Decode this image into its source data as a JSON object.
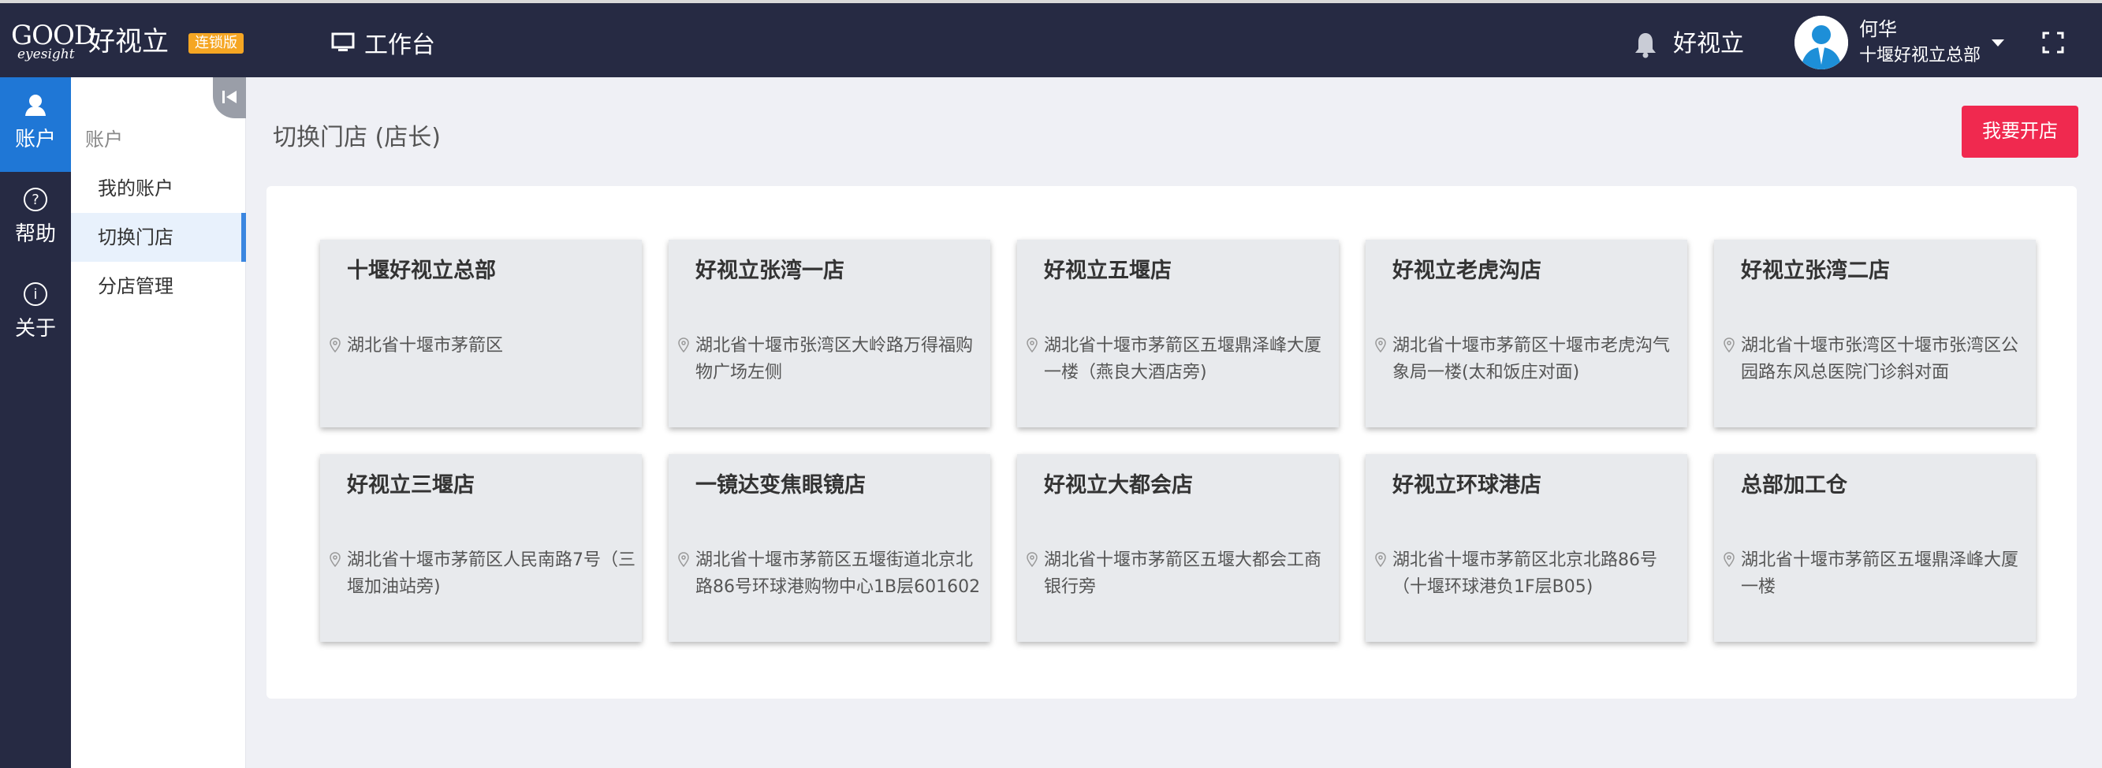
{
  "header": {
    "logo_text": "GOOD",
    "logo_subtext": "eyesight",
    "brand": "好视立",
    "edition_badge": "连锁版",
    "workbench": "工作台",
    "notification_label": "好视立",
    "user_name": "何华",
    "user_org": "十堰好视立总部"
  },
  "rail": {
    "items": [
      {
        "label": "账户",
        "icon": "user-icon"
      },
      {
        "label": "帮助",
        "icon": "help-icon"
      },
      {
        "label": "关于",
        "icon": "info-icon"
      }
    ]
  },
  "submenu": {
    "title": "账户",
    "items": [
      {
        "label": "我的账户"
      },
      {
        "label": "切换门店"
      },
      {
        "label": "分店管理"
      }
    ]
  },
  "main": {
    "page_title": "切换门店 (店长)",
    "open_store_button": "我要开店",
    "stores": [
      {
        "name": "十堰好视立总部",
        "address": "湖北省十堰市茅箭区"
      },
      {
        "name": "好视立张湾一店",
        "address": "湖北省十堰市张湾区大岭路万得福购物广场左侧"
      },
      {
        "name": "好视立五堰店",
        "address": "湖北省十堰市茅箭区五堰鼎泽峰大厦一楼（燕良大酒店旁)"
      },
      {
        "name": "好视立老虎沟店",
        "address": "湖北省十堰市茅箭区十堰市老虎沟气象局一楼(太和饭庄对面)"
      },
      {
        "name": "好视立张湾二店",
        "address": "湖北省十堰市张湾区十堰市张湾区公园路东风总医院门诊斜对面"
      },
      {
        "name": "好视立三堰店",
        "address": "湖北省十堰市茅箭区人民南路7号（三堰加油站旁)"
      },
      {
        "name": "一镜达变焦眼镜店",
        "address": "湖北省十堰市茅箭区五堰街道北京北路86号环球港购物中心1B层601602"
      },
      {
        "name": "好视立大都会店",
        "address": "湖北省十堰市茅箭区五堰大都会工商银行旁"
      },
      {
        "name": "好视立环球港店",
        "address": "湖北省十堰市茅箭区北京北路86号（十堰环球港负1F层B05)"
      },
      {
        "name": "总部加工仓",
        "address": "湖北省十堰市茅箭区五堰鼎泽峰大厦一楼"
      }
    ]
  },
  "colors": {
    "topbar": "#262a43",
    "rail_active": "#1f77d6",
    "edition_badge": "#f5a623",
    "open_store_button": "#f0294f"
  }
}
